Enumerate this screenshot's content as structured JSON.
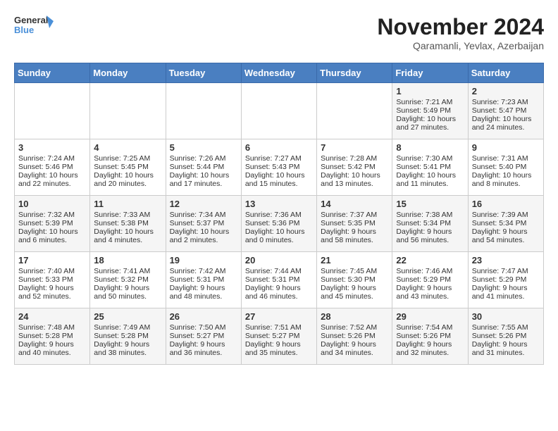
{
  "logo": {
    "line1": "General",
    "line2": "Blue"
  },
  "title": "November 2024",
  "subtitle": "Qaramanli, Yevlax, Azerbaijan",
  "days_of_week": [
    "Sunday",
    "Monday",
    "Tuesday",
    "Wednesday",
    "Thursday",
    "Friday",
    "Saturday"
  ],
  "weeks": [
    [
      {
        "day": "",
        "content": ""
      },
      {
        "day": "",
        "content": ""
      },
      {
        "day": "",
        "content": ""
      },
      {
        "day": "",
        "content": ""
      },
      {
        "day": "",
        "content": ""
      },
      {
        "day": "1",
        "content": "Sunrise: 7:21 AM\nSunset: 5:49 PM\nDaylight: 10 hours and 27 minutes."
      },
      {
        "day": "2",
        "content": "Sunrise: 7:23 AM\nSunset: 5:47 PM\nDaylight: 10 hours and 24 minutes."
      }
    ],
    [
      {
        "day": "3",
        "content": "Sunrise: 7:24 AM\nSunset: 5:46 PM\nDaylight: 10 hours and 22 minutes."
      },
      {
        "day": "4",
        "content": "Sunrise: 7:25 AM\nSunset: 5:45 PM\nDaylight: 10 hours and 20 minutes."
      },
      {
        "day": "5",
        "content": "Sunrise: 7:26 AM\nSunset: 5:44 PM\nDaylight: 10 hours and 17 minutes."
      },
      {
        "day": "6",
        "content": "Sunrise: 7:27 AM\nSunset: 5:43 PM\nDaylight: 10 hours and 15 minutes."
      },
      {
        "day": "7",
        "content": "Sunrise: 7:28 AM\nSunset: 5:42 PM\nDaylight: 10 hours and 13 minutes."
      },
      {
        "day": "8",
        "content": "Sunrise: 7:30 AM\nSunset: 5:41 PM\nDaylight: 10 hours and 11 minutes."
      },
      {
        "day": "9",
        "content": "Sunrise: 7:31 AM\nSunset: 5:40 PM\nDaylight: 10 hours and 8 minutes."
      }
    ],
    [
      {
        "day": "10",
        "content": "Sunrise: 7:32 AM\nSunset: 5:39 PM\nDaylight: 10 hours and 6 minutes."
      },
      {
        "day": "11",
        "content": "Sunrise: 7:33 AM\nSunset: 5:38 PM\nDaylight: 10 hours and 4 minutes."
      },
      {
        "day": "12",
        "content": "Sunrise: 7:34 AM\nSunset: 5:37 PM\nDaylight: 10 hours and 2 minutes."
      },
      {
        "day": "13",
        "content": "Sunrise: 7:36 AM\nSunset: 5:36 PM\nDaylight: 10 hours and 0 minutes."
      },
      {
        "day": "14",
        "content": "Sunrise: 7:37 AM\nSunset: 5:35 PM\nDaylight: 9 hours and 58 minutes."
      },
      {
        "day": "15",
        "content": "Sunrise: 7:38 AM\nSunset: 5:34 PM\nDaylight: 9 hours and 56 minutes."
      },
      {
        "day": "16",
        "content": "Sunrise: 7:39 AM\nSunset: 5:34 PM\nDaylight: 9 hours and 54 minutes."
      }
    ],
    [
      {
        "day": "17",
        "content": "Sunrise: 7:40 AM\nSunset: 5:33 PM\nDaylight: 9 hours and 52 minutes."
      },
      {
        "day": "18",
        "content": "Sunrise: 7:41 AM\nSunset: 5:32 PM\nDaylight: 9 hours and 50 minutes."
      },
      {
        "day": "19",
        "content": "Sunrise: 7:42 AM\nSunset: 5:31 PM\nDaylight: 9 hours and 48 minutes."
      },
      {
        "day": "20",
        "content": "Sunrise: 7:44 AM\nSunset: 5:31 PM\nDaylight: 9 hours and 46 minutes."
      },
      {
        "day": "21",
        "content": "Sunrise: 7:45 AM\nSunset: 5:30 PM\nDaylight: 9 hours and 45 minutes."
      },
      {
        "day": "22",
        "content": "Sunrise: 7:46 AM\nSunset: 5:29 PM\nDaylight: 9 hours and 43 minutes."
      },
      {
        "day": "23",
        "content": "Sunrise: 7:47 AM\nSunset: 5:29 PM\nDaylight: 9 hours and 41 minutes."
      }
    ],
    [
      {
        "day": "24",
        "content": "Sunrise: 7:48 AM\nSunset: 5:28 PM\nDaylight: 9 hours and 40 minutes."
      },
      {
        "day": "25",
        "content": "Sunrise: 7:49 AM\nSunset: 5:28 PM\nDaylight: 9 hours and 38 minutes."
      },
      {
        "day": "26",
        "content": "Sunrise: 7:50 AM\nSunset: 5:27 PM\nDaylight: 9 hours and 36 minutes."
      },
      {
        "day": "27",
        "content": "Sunrise: 7:51 AM\nSunset: 5:27 PM\nDaylight: 9 hours and 35 minutes."
      },
      {
        "day": "28",
        "content": "Sunrise: 7:52 AM\nSunset: 5:26 PM\nDaylight: 9 hours and 34 minutes."
      },
      {
        "day": "29",
        "content": "Sunrise: 7:54 AM\nSunset: 5:26 PM\nDaylight: 9 hours and 32 minutes."
      },
      {
        "day": "30",
        "content": "Sunrise: 7:55 AM\nSunset: 5:26 PM\nDaylight: 9 hours and 31 minutes."
      }
    ]
  ]
}
